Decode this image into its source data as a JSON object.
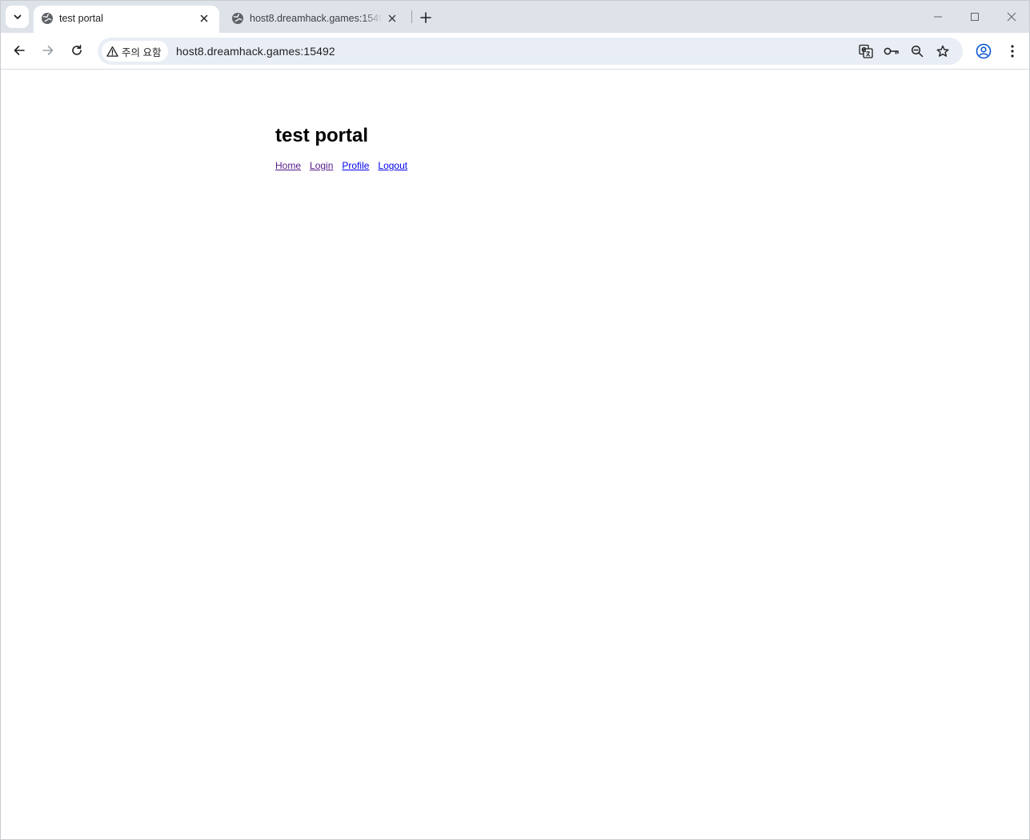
{
  "browser": {
    "tabs": [
      {
        "title": "test portal",
        "active": true,
        "icon": "globe-icon"
      },
      {
        "title": "host8.dreamhack.games:15492",
        "active": false,
        "icon": "globe-icon"
      }
    ],
    "security_chip": "주의 요함",
    "url": "host8.dreamhack.games:15492",
    "toolbar_icons": [
      "back-icon",
      "forward-icon",
      "reload-icon",
      "translate-icon",
      "key-icon",
      "zoom-icon",
      "star-icon",
      "profile-icon",
      "menu-icon"
    ]
  },
  "page": {
    "title": "test portal",
    "nav": [
      {
        "label": "Home",
        "visited": true
      },
      {
        "label": "Login",
        "visited": true
      },
      {
        "label": "Profile",
        "visited": false
      },
      {
        "label": "Logout",
        "visited": false
      }
    ]
  },
  "colors": {
    "link": "#0000ee",
    "link_visited": "#551a8b",
    "tabstrip": "#dee3ea",
    "omnibox": "#e9eef6"
  }
}
